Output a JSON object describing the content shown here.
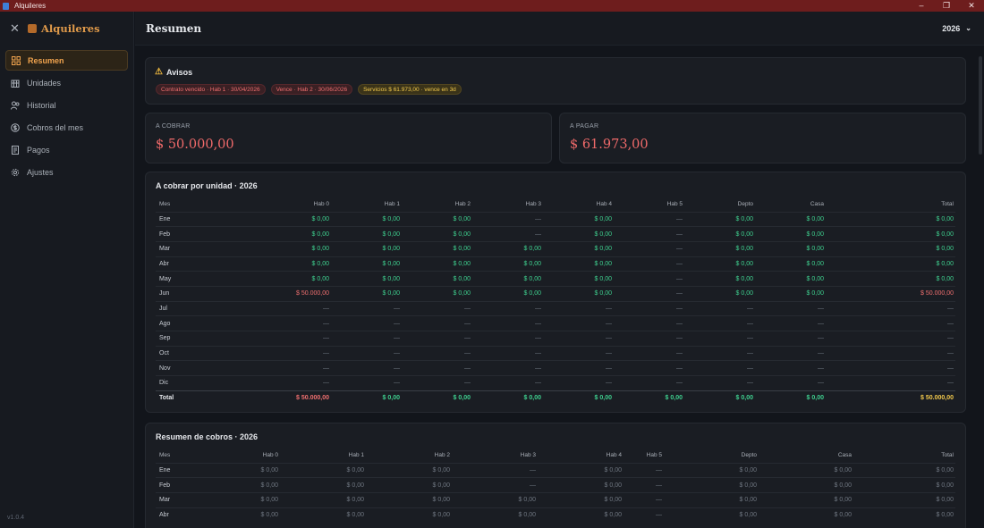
{
  "window": {
    "title": "Alquileres",
    "controls": [
      "–",
      "❐",
      "✕"
    ]
  },
  "sidebar": {
    "brand": "Alquileres",
    "close_glyph": "✕",
    "items": [
      {
        "label": "Resumen",
        "icon": "dashboard-icon",
        "active": true
      },
      {
        "label": "Unidades",
        "icon": "building-icon",
        "active": false
      },
      {
        "label": "Historial",
        "icon": "users-icon",
        "active": false
      },
      {
        "label": "Cobros del mes",
        "icon": "dollar-icon",
        "active": false
      },
      {
        "label": "Pagos",
        "icon": "receipt-icon",
        "active": false
      },
      {
        "label": "Ajustes",
        "icon": "gear-icon",
        "active": false
      }
    ],
    "version": "v1.0.4"
  },
  "header": {
    "title": "Resumen",
    "year": "2026"
  },
  "avisos": {
    "title": "Avisos",
    "chips": [
      {
        "text": "Contrato vencido · Hab 1 · 30/04/2026",
        "tone": "red"
      },
      {
        "text": "Vence · Hab 2 · 30/06/2026",
        "tone": "red"
      },
      {
        "text": "Servicios $ 61.973,00 · vence en 3d",
        "tone": "yellow"
      }
    ]
  },
  "kpis": {
    "cobrar": {
      "label": "A COBRAR",
      "value": "$ 50.000,00"
    },
    "pagar": {
      "label": "A PAGAR",
      "value": "$ 61.973,00"
    }
  },
  "tabla_cobrar": {
    "title": "A cobrar por unidad · 2026",
    "columns": [
      "Mes",
      "Hab 0",
      "Hab 1",
      "Hab 2",
      "Hab 3",
      "Hab 4",
      "Hab 5",
      "Depto",
      "Casa",
      "Total"
    ],
    "rows": [
      [
        "Ene",
        "$ 0,00",
        "$ 0,00",
        "$ 0,00",
        "—",
        "$ 0,00",
        "—",
        "$ 0,00",
        "$ 0,00",
        "$ 0,00"
      ],
      [
        "Feb",
        "$ 0,00",
        "$ 0,00",
        "$ 0,00",
        "—",
        "$ 0,00",
        "—",
        "$ 0,00",
        "$ 0,00",
        "$ 0,00"
      ],
      [
        "Mar",
        "$ 0,00",
        "$ 0,00",
        "$ 0,00",
        "$ 0,00",
        "$ 0,00",
        "—",
        "$ 0,00",
        "$ 0,00",
        "$ 0,00"
      ],
      [
        "Abr",
        "$ 0,00",
        "$ 0,00",
        "$ 0,00",
        "$ 0,00",
        "$ 0,00",
        "—",
        "$ 0,00",
        "$ 0,00",
        "$ 0,00"
      ],
      [
        "May",
        "$ 0,00",
        "$ 0,00",
        "$ 0,00",
        "$ 0,00",
        "$ 0,00",
        "—",
        "$ 0,00",
        "$ 0,00",
        "$ 0,00"
      ],
      [
        "Jun",
        "$ 50.000,00",
        "$ 0,00",
        "$ 0,00",
        "$ 0,00",
        "$ 0,00",
        "—",
        "$ 0,00",
        "$ 0,00",
        "$ 50.000,00"
      ],
      [
        "Jul",
        "—",
        "—",
        "—",
        "—",
        "—",
        "—",
        "—",
        "—",
        "—"
      ],
      [
        "Ago",
        "—",
        "—",
        "—",
        "—",
        "—",
        "—",
        "—",
        "—",
        "—"
      ],
      [
        "Sep",
        "—",
        "—",
        "—",
        "—",
        "—",
        "—",
        "—",
        "—",
        "—"
      ],
      [
        "Oct",
        "—",
        "—",
        "—",
        "—",
        "—",
        "—",
        "—",
        "—",
        "—"
      ],
      [
        "Nov",
        "—",
        "—",
        "—",
        "—",
        "—",
        "—",
        "—",
        "—",
        "—"
      ],
      [
        "Dic",
        "—",
        "—",
        "—",
        "—",
        "—",
        "—",
        "—",
        "—",
        "—"
      ]
    ],
    "total": [
      "Total",
      "$ 50.000,00",
      "$ 0,00",
      "$ 0,00",
      "$ 0,00",
      "$ 0,00",
      "$ 0,00",
      "$ 0,00",
      "$ 0,00",
      "$ 50.000,00"
    ]
  },
  "tabla_cobros": {
    "title": "Resumen de cobros · 2026",
    "columns": [
      "Mes",
      "Hab 0",
      "Hab 1",
      "Hab 2",
      "Hab 3",
      "Hab 4",
      "Hab 5",
      "Depto",
      "Casa",
      "Total"
    ],
    "rows": [
      [
        "Ene",
        "$ 0,00",
        "$ 0,00",
        "$ 0,00",
        "—",
        "$ 0,00",
        "—",
        "$ 0,00",
        "$ 0,00",
        "$ 0,00"
      ],
      [
        "Feb",
        "$ 0,00",
        "$ 0,00",
        "$ 0,00",
        "—",
        "$ 0,00",
        "—",
        "$ 0,00",
        "$ 0,00",
        "$ 0,00"
      ],
      [
        "Mar",
        "$ 0,00",
        "$ 0,00",
        "$ 0,00",
        "$ 0,00",
        "$ 0,00",
        "—",
        "$ 0,00",
        "$ 0,00",
        "$ 0,00"
      ],
      [
        "Abr",
        "$ 0,00",
        "$ 0,00",
        "$ 0,00",
        "$ 0,00",
        "$ 0,00",
        "—",
        "$ 0,00",
        "$ 0,00",
        "$ 0,00"
      ]
    ]
  },
  "colors": {
    "accent": "#f0a34e",
    "green": "#3ecf8e",
    "red": "#ef6f6f",
    "yellow": "#f2c94c"
  }
}
